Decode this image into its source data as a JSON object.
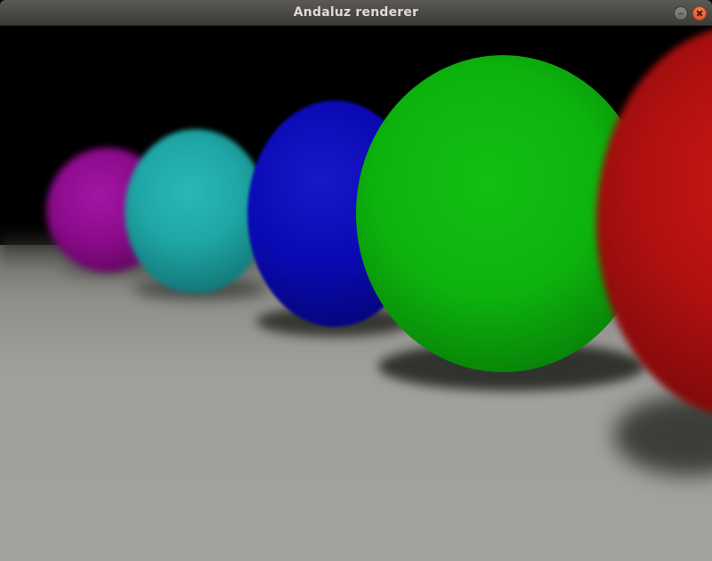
{
  "window": {
    "title": "Andaluz renderer",
    "buttons": [
      "minimize-icon",
      "close-icon"
    ]
  },
  "scene": {
    "spheres": [
      {
        "name": "magenta-sphere",
        "color": "#8a0a8a"
      },
      {
        "name": "cyan-sphere",
        "color": "#1fa6a6"
      },
      {
        "name": "blue-sphere",
        "color": "#0a0ab4"
      },
      {
        "name": "green-sphere",
        "color": "#0db30d"
      },
      {
        "name": "red-sphere",
        "color": "#c01010"
      }
    ],
    "floor_color": "#a3a29e",
    "background_color": "#000000"
  }
}
